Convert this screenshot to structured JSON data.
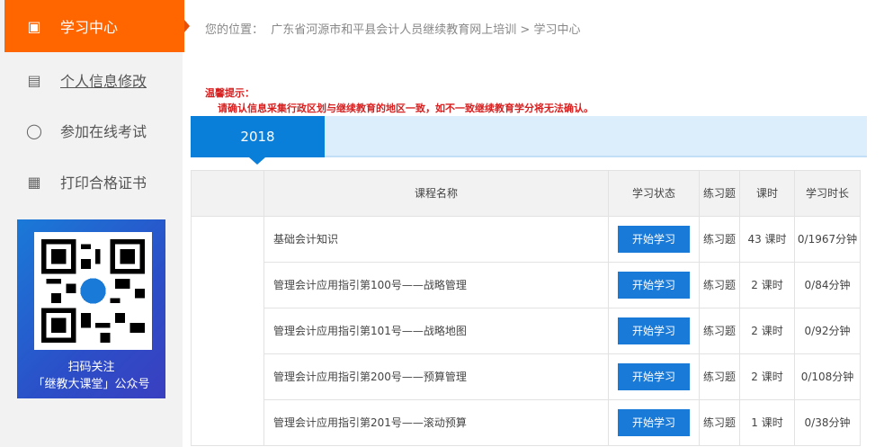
{
  "sidebar": {
    "items": [
      {
        "label": "学习中心",
        "icon": "lock-icon",
        "active": true
      },
      {
        "label": "个人信息修改",
        "icon": "calendar-card-icon"
      },
      {
        "label": "参加在线考试",
        "icon": "user-icon"
      },
      {
        "label": "打印合格证书",
        "icon": "calendar-icon"
      }
    ],
    "qr": {
      "line1": "扫码关注",
      "line2": "「继教大课堂」公众号"
    }
  },
  "breadcrumb": {
    "prefix": "您的位置：",
    "path": "广东省河源市和平县会计人员继续教育网上培训 > 学习中心"
  },
  "notice": {
    "title": "温馨提示：",
    "text": "请确认信息采集行政区划与继续教育的地区一致，如不一致继续教育学分将无法确认。"
  },
  "year_tab": "2018",
  "table": {
    "headers": [
      "",
      "课程名称",
      "学习状态",
      "练习题",
      "课时",
      "学习时长"
    ],
    "rows": [
      {
        "name": "基础会计知识",
        "button": "开始学习",
        "practice": "练习题",
        "hours": "43 课时",
        "duration": "0/1967分钟"
      },
      {
        "name": "管理会计应用指引第100号——战略管理",
        "button": "开始学习",
        "practice": "练习题",
        "hours": "2 课时",
        "duration": "0/84分钟"
      },
      {
        "name": "管理会计应用指引第101号——战略地图",
        "button": "开始学习",
        "practice": "练习题",
        "hours": "2 课时",
        "duration": "0/92分钟"
      },
      {
        "name": "管理会计应用指引第200号——预算管理",
        "button": "开始学习",
        "practice": "练习题",
        "hours": "2 课时",
        "duration": "0/108分钟"
      },
      {
        "name": "管理会计应用指引第201号——滚动预算",
        "button": "开始学习",
        "practice": "练习题",
        "hours": "1 课时",
        "duration": "0/38分钟"
      }
    ]
  }
}
